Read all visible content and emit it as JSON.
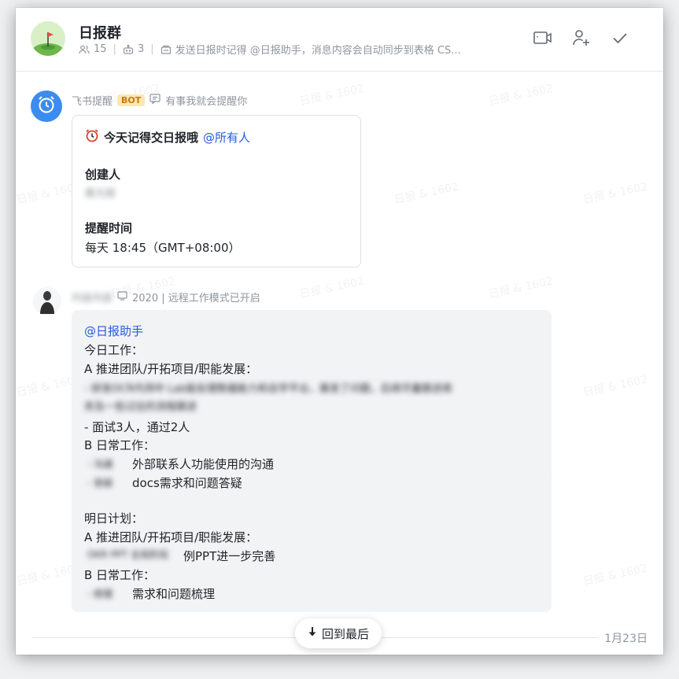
{
  "header": {
    "title": "日报群",
    "member_count": "15",
    "bot_count": "3",
    "announcement": "发送日报时记得 @日报助手，消息内容会自动同步到表格 CS..."
  },
  "bot_message": {
    "sender": "飞书提醒",
    "badge": "BOT",
    "signature": "有事我就会提醒你",
    "card": {
      "title": "今天记得交日报哦",
      "mention": "@所有人",
      "creator_label": "创建人",
      "creator_value": "蔡元丽",
      "time_label": "提醒时间",
      "time_value": "每天 18:45（GMT+08:00）"
    }
  },
  "user_message": {
    "sender": "内容内容",
    "status": "2020 | 远程工作模式已开启",
    "lines": [
      "@日报助手",
      "今日工作：",
      "A 推进团队/开拓项目/职能发展：",
      "- 研发OCR内测中 Lab能处理数据能力和自学平台，展发了问题，后续尽量跟进商",
      "务及一些过往的流程跟进",
      "- 面试3人，通过2人",
      "B 日常工作：",
      "外部联系人功能使用的沟通",
      "docs需求和问题答疑",
      "明日计划：",
      "A 推进团队/开拓项目/职能发展：",
      "OKR PPT 全局阶段",
      "例PPT进一步完善",
      "B 日常工作：",
      "需求和问题梳理",
      "- 沟通",
      "- 答疑",
      "- 梳理"
    ]
  },
  "back_to_latest": "回到最后",
  "date_label": "1月23日",
  "watermark": "日报 & 1602",
  "colors": {
    "accent": "#245bdb",
    "bot_avatar": "#3c8cf0",
    "badge_bg": "#fbe7b5",
    "badge_text": "#c57c00"
  },
  "icons": [
    "group-avatar-icon",
    "members-icon",
    "bot-icon",
    "announcement-icon",
    "video-call-icon",
    "add-member-icon",
    "check-icon",
    "alarm-clock-icon",
    "signature-icon",
    "status-icon",
    "arrow-down-icon"
  ]
}
